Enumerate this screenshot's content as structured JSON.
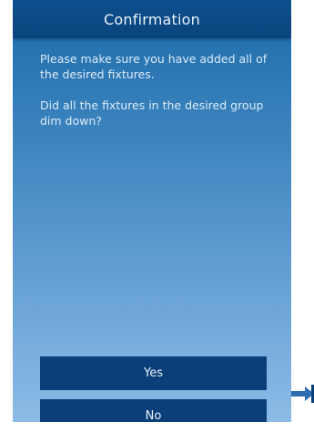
{
  "header": {
    "title": "Confirmation"
  },
  "content": {
    "paragraph_1": "Please make sure you have added all of the desired fixtures.",
    "paragraph_2": "Did all the fixtures in the desired group dim down?"
  },
  "buttons": {
    "yes_label": "Yes",
    "no_label": "No"
  },
  "colors": {
    "header": "#0d4f8d",
    "button": "#0a3f79",
    "arrow": "#2f6db3"
  },
  "icons": {
    "arrow": "arrow-right-icon"
  }
}
